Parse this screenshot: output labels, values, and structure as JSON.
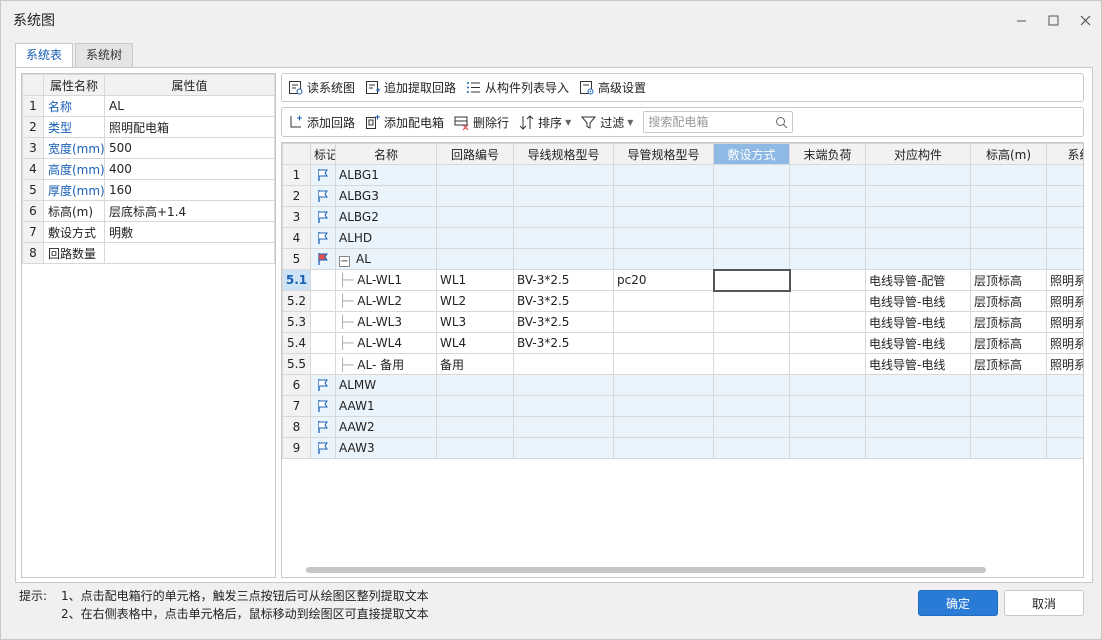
{
  "window": {
    "title": "系统图"
  },
  "tabs": [
    {
      "label": "系统表",
      "active": true
    },
    {
      "label": "系统树",
      "active": false
    }
  ],
  "properties": {
    "headers": [
      "属性名称",
      "属性值"
    ],
    "rows": [
      {
        "index": "1",
        "name": "名称",
        "value": "AL",
        "highlight": true
      },
      {
        "index": "2",
        "name": "类型",
        "value": "照明配电箱",
        "highlight": true
      },
      {
        "index": "3",
        "name": "宽度(mm)",
        "value": "500",
        "highlight": true
      },
      {
        "index": "4",
        "name": "高度(mm)",
        "value": "400",
        "highlight": true
      },
      {
        "index": "5",
        "name": "厚度(mm)",
        "value": "160",
        "highlight": true
      },
      {
        "index": "6",
        "name": "标高(m)",
        "value": "层底标高+1.4",
        "highlight": false
      },
      {
        "index": "7",
        "name": "敷设方式",
        "value": "明敷",
        "highlight": false
      },
      {
        "index": "8",
        "name": "回路数量",
        "value": "",
        "highlight": false
      }
    ]
  },
  "toolbar1": {
    "read": "读系统图",
    "append": "追加提取回路",
    "import": "从构件列表导入",
    "advanced": "高级设置"
  },
  "toolbar2": {
    "add_circuit": "添加回路",
    "add_box": "添加配电箱",
    "delete_row": "删除行",
    "sort": "排序",
    "filter": "过滤",
    "search_placeholder": "搜索配电箱"
  },
  "grid": {
    "headers": [
      "标记",
      "名称",
      "回路编号",
      "导线规格型号",
      "导管规格型号",
      "敷设方式",
      "末端负荷",
      "对应构件",
      "标高(m)",
      "系统"
    ],
    "selected_column": "敷设方式",
    "rows": [
      {
        "index": "1",
        "type": "box",
        "name": "ALBG1"
      },
      {
        "index": "2",
        "type": "box",
        "name": "ALBG3"
      },
      {
        "index": "3",
        "type": "box",
        "name": "ALBG2"
      },
      {
        "index": "4",
        "type": "box",
        "name": "ALHD"
      },
      {
        "index": "5",
        "type": "box-expanded",
        "name": "AL",
        "expander": "−"
      },
      {
        "index": "5.1",
        "type": "child",
        "name": "AL-WL1",
        "circuit": "WL1",
        "wire": "BV-3*2.5",
        "conduit": "pc20",
        "component": "电线导管-配管",
        "elevation": "层顶标高",
        "system": "照明系",
        "current": true
      },
      {
        "index": "5.2",
        "type": "child",
        "name": "AL-WL2",
        "circuit": "WL2",
        "wire": "BV-3*2.5",
        "conduit": "",
        "component": "电线导管-电线",
        "elevation": "层顶标高",
        "system": "照明系"
      },
      {
        "index": "5.3",
        "type": "child",
        "name": "AL-WL3",
        "circuit": "WL3",
        "wire": "BV-3*2.5",
        "conduit": "",
        "component": "电线导管-电线",
        "elevation": "层顶标高",
        "system": "照明系"
      },
      {
        "index": "5.4",
        "type": "child",
        "name": "AL-WL4",
        "circuit": "WL4",
        "wire": "BV-3*2.5",
        "conduit": "",
        "component": "电线导管-电线",
        "elevation": "层顶标高",
        "system": "照明系"
      },
      {
        "index": "5.5",
        "type": "child",
        "name": "AL- 备用",
        "circuit": "备用",
        "wire": "",
        "conduit": "",
        "component": "电线导管-电线",
        "elevation": "层顶标高",
        "system": "照明系"
      },
      {
        "index": "6",
        "type": "box",
        "name": "ALMW"
      },
      {
        "index": "7",
        "type": "box",
        "name": "AAW1"
      },
      {
        "index": "8",
        "type": "box",
        "name": "AAW2"
      },
      {
        "index": "9",
        "type": "box",
        "name": "AAW3"
      }
    ]
  },
  "hints": {
    "label": "提示:",
    "line1": "1、点击配电箱行的单元格，触发三点按钮后可从绘图区整列提取文本",
    "line2": "2、在右侧表格中，点击单元格后，鼠标移动到绘图区可直接提取文本"
  },
  "buttons": {
    "ok": "确定",
    "cancel": "取消"
  },
  "colors": {
    "accent": "#2a7bd5",
    "link_text": "#1a5fb4",
    "box_row_bg": "#eaf4fc"
  }
}
